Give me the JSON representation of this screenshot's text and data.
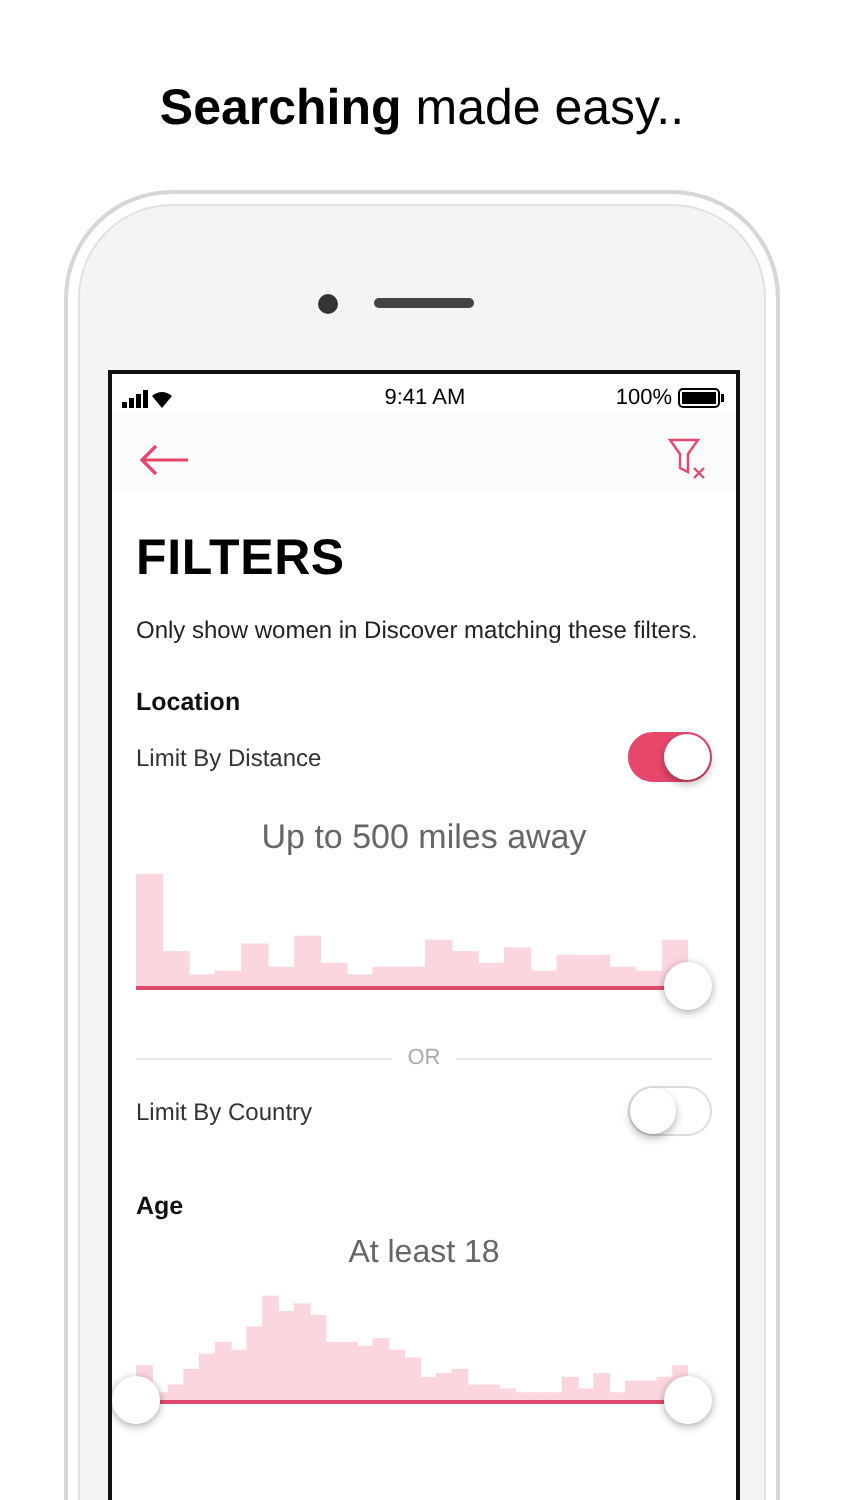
{
  "headline": "**Searching** made easy..",
  "status_bar": {
    "time": "9:41 AM",
    "battery": "100%"
  },
  "title": "FILTERS",
  "subtitle": "Only show women in Discover matching these filters.",
  "sections": [
    {
      "kind": "location",
      "heading": "Location",
      "distance_toggle": {
        "label": "Limit By Distance",
        "on": true
      },
      "reading": "Up to 500 miles away",
      "slider": {
        "level": 1
      },
      "divider": "OR",
      "country_toggle": {
        "label": "Limit By Country",
        "on": false
      }
    },
    {
      "kind": "age",
      "heading": "Age",
      "reading": "At least 18",
      "range": [
        {
          "level": 0
        },
        {
          "level": 1
        }
      ]
    }
  ]
}
